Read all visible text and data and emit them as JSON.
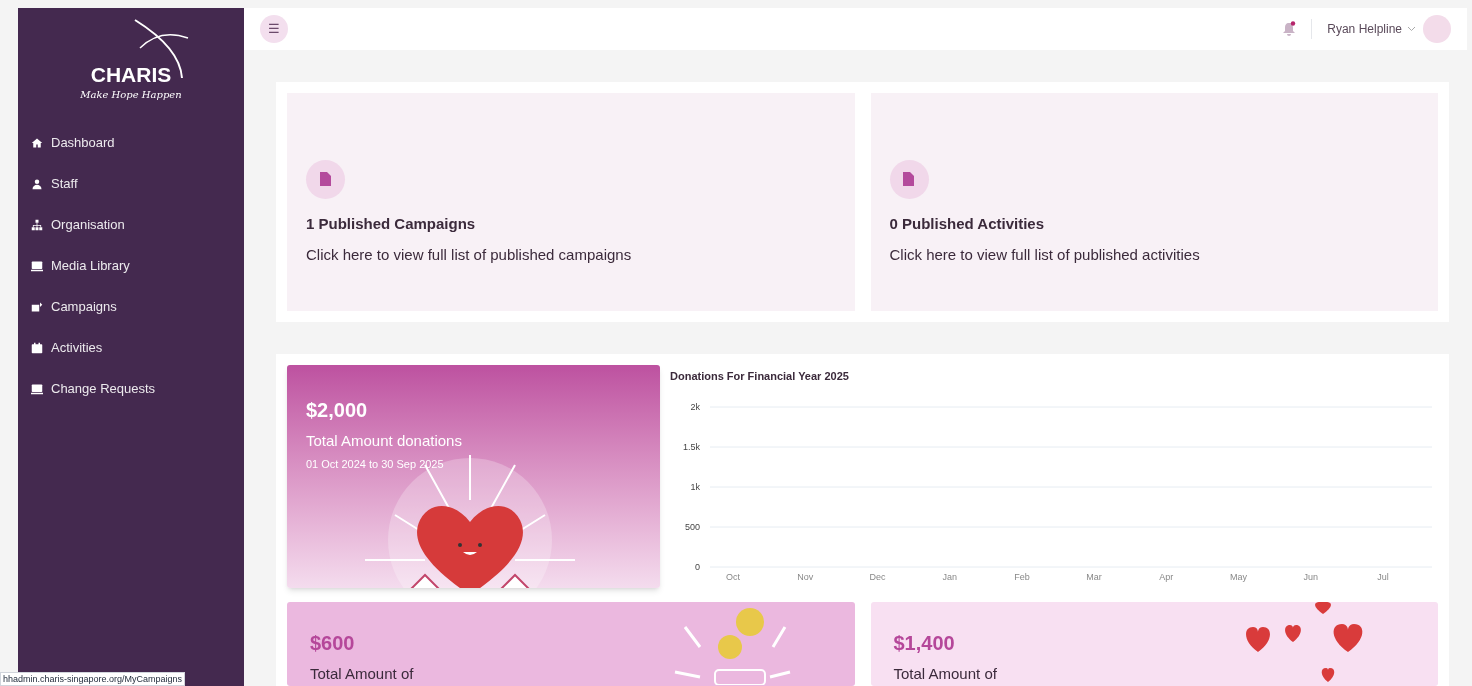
{
  "sidebar": {
    "logo": {
      "name": "CHARIS",
      "tagline": "Make Hope Happen"
    },
    "items": [
      {
        "label": "Dashboard",
        "selected": false
      },
      {
        "label": "Staff",
        "selected": false
      },
      {
        "label": "Organisation",
        "selected": false
      },
      {
        "label": "Media Library",
        "selected": false
      },
      {
        "label": "Campaigns",
        "selected": false
      },
      {
        "label": "Activities",
        "selected": false
      },
      {
        "label": "Change Requests",
        "selected": false
      }
    ]
  },
  "header": {
    "menu_icon": "☰",
    "notification": true,
    "user_name": "Ryan Helpline"
  },
  "summary_cards": [
    {
      "title": "1 Published Campaigns",
      "text": "Click here to view full list of published campaigns"
    },
    {
      "title": "0 Published Activities",
      "text": "Click here to view full list of published activities"
    }
  ],
  "total_card": {
    "amount": "$2,000",
    "label": "Total Amount donations",
    "period": "01 Oct 2024 to 30 Sep 2025"
  },
  "chart": {
    "chart_data": {
      "type": "line",
      "title": "Donations For Financial Year 2025",
      "grid": true,
      "categories": [
        "Oct",
        "Nov",
        "Dec",
        "Jan",
        "Feb",
        "Mar",
        "Apr",
        "May",
        "Jun",
        "Jul"
      ],
      "ylim": [
        0,
        2000
      ],
      "yticks": [
        {
          "value": 0,
          "label": "0"
        },
        {
          "value": 500,
          "label": "500"
        },
        {
          "value": 1000,
          "label": "1k"
        },
        {
          "value": 1500,
          "label": "1.5k"
        },
        {
          "value": 2000,
          "label": "2k"
        }
      ]
    }
  },
  "method_cards": [
    {
      "kind": "coins",
      "amount": "$600",
      "label": "Total Amount of"
    },
    {
      "kind": "hearts",
      "amount": "$1,400",
      "label": "Total Amount of"
    }
  ],
  "status_bar": {
    "url": "hhadmin.charis-singapore.org/MyCampaigns"
  }
}
